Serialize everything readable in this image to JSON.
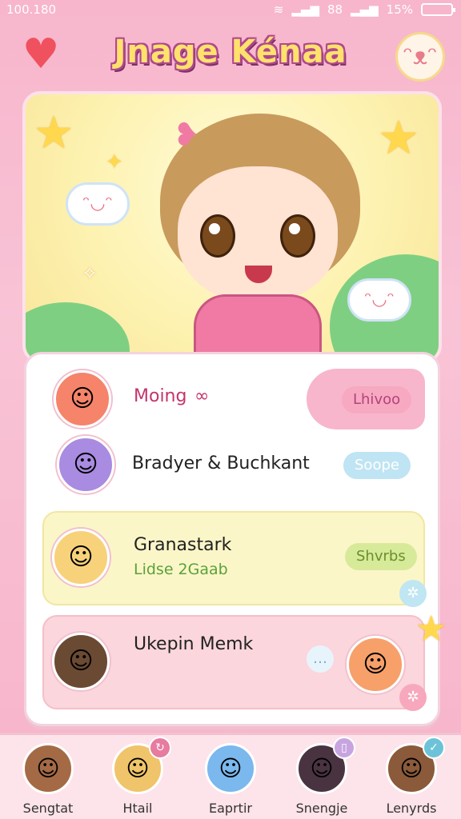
{
  "status_bar": {
    "time": "100.180",
    "signal_label": "88",
    "battery_text": "15%"
  },
  "header": {
    "title": "Jnage Kénaa"
  },
  "list": [
    {
      "title": "Moing",
      "title_suffix": "∞",
      "pill_label": "Lhivoo",
      "pill_color": "#f6a9c1",
      "pill_text_color": "#b5437a"
    },
    {
      "title": "Bradyer & Buchkant",
      "pill_label": "Soope",
      "pill_color": "#bfe4f3",
      "pill_text_color": "#ffffff"
    },
    {
      "title": "Granastark",
      "subtitle": "Lidse 2Gaab",
      "pill_label": "Shvrbs",
      "pill_color": "#d7ea9a",
      "pill_text_color": "#6a8f2a"
    },
    {
      "title": "Ukepin Memk"
    }
  ],
  "nav": [
    {
      "label": "Sengtat"
    },
    {
      "label": "Htail"
    },
    {
      "label": "Eaprtir"
    },
    {
      "label": "Snengje"
    },
    {
      "label": "Lenyrds"
    }
  ],
  "icons": {
    "heart": "heart-icon",
    "mascot": "cloud-mascot-icon",
    "star": "star-icon",
    "cloud": "cloud-icon",
    "sparkle": "sparkle-icon"
  }
}
